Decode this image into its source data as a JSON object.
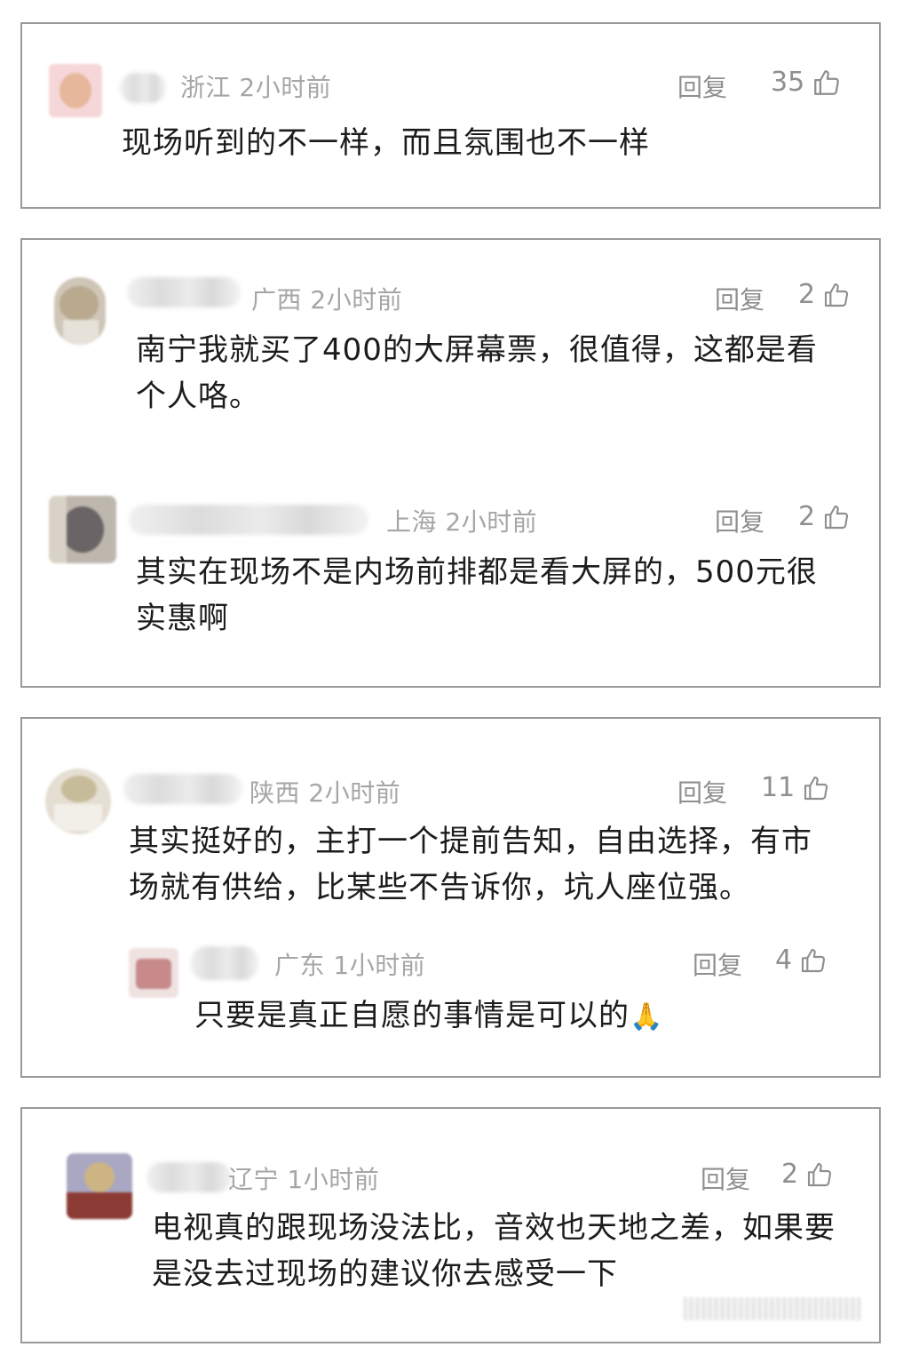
{
  "threads": [
    {
      "comments": [
        {
          "region": "浙江",
          "time": "2小时前",
          "reply_label": "回复",
          "likes": "35",
          "text": "现场听到的不一样，而且氛围也不一样"
        }
      ]
    },
    {
      "comments": [
        {
          "region": "广西",
          "time": "2小时前",
          "reply_label": "回复",
          "likes": "2",
          "text": "南宁我就买了400的大屏幕票，很值得，这都是看个人咯。"
        },
        {
          "region": "上海",
          "time": "2小时前",
          "reply_label": "回复",
          "likes": "2",
          "text": "其实在现场不是内场前排都是看大屏的，500元很实惠啊"
        }
      ]
    },
    {
      "comments": [
        {
          "region": "陕西",
          "time": "2小时前",
          "reply_label": "回复",
          "likes": "11",
          "text": "其实挺好的，主打一个提前告知，自由选择，有市场就有供给，比某些不告诉你，坑人座位强。"
        }
      ],
      "replies": [
        {
          "region": "广东",
          "time": "1小时前",
          "reply_label": "回复",
          "likes": "4",
          "text": "只要是真正自愿的事情是可以的",
          "emoji": "🙏"
        }
      ]
    },
    {
      "comments": [
        {
          "region": "辽宁",
          "time": "1小时前",
          "reply_label": "回复",
          "likes": "2",
          "text": "电视真的跟现场没法比，音效也天地之差，如果要是没去过现场的建议你去感受一下"
        }
      ]
    }
  ],
  "colors": {
    "card_border": "#9a9a9a",
    "meta_text": "#a6a6a6",
    "body_text": "#1c1c1c"
  },
  "icons": {
    "like": "thumbs-up-outline-icon",
    "emoji": "praying-hands-emoji"
  }
}
